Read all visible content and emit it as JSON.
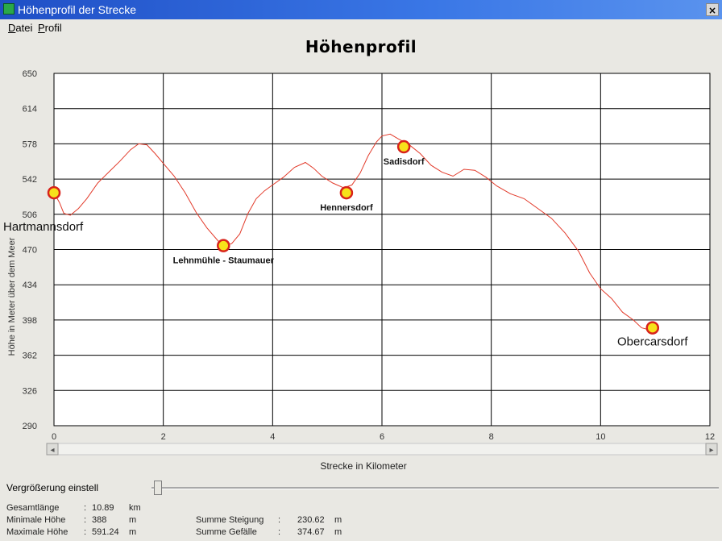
{
  "window": {
    "title": "Höhenprofil der Strecke",
    "close_glyph": "×"
  },
  "menu": [
    "Datei",
    "Profil"
  ],
  "chart_data": {
    "type": "line",
    "title": "Höhenprofil",
    "xlabel": "Strecke in Kilometer",
    "ylabel": "Höhe in Meter über dem Meer",
    "xlim": [
      0,
      12
    ],
    "ylim": [
      290,
      650
    ],
    "xticks": [
      0,
      2,
      4,
      6,
      8,
      10,
      12
    ],
    "yticks": [
      650,
      614,
      578,
      542,
      506,
      470,
      434,
      398,
      362,
      326,
      290
    ],
    "grid": true,
    "line_color": "#e23a2a",
    "series": [
      {
        "points": [
          [
            0.0,
            528
          ],
          [
            0.1,
            518
          ],
          [
            0.18,
            507
          ],
          [
            0.3,
            505
          ],
          [
            0.45,
            512
          ],
          [
            0.6,
            522
          ],
          [
            0.8,
            538
          ],
          [
            1.0,
            549
          ],
          [
            1.2,
            560
          ],
          [
            1.4,
            572
          ],
          [
            1.55,
            578
          ],
          [
            1.7,
            577
          ],
          [
            1.85,
            568
          ],
          [
            2.0,
            558
          ],
          [
            2.2,
            545
          ],
          [
            2.4,
            528
          ],
          [
            2.6,
            508
          ],
          [
            2.8,
            492
          ],
          [
            3.0,
            479
          ],
          [
            3.1,
            474
          ],
          [
            3.25,
            476
          ],
          [
            3.4,
            486
          ],
          [
            3.55,
            507
          ],
          [
            3.7,
            522
          ],
          [
            3.85,
            530
          ],
          [
            4.0,
            536
          ],
          [
            4.2,
            544
          ],
          [
            4.4,
            554
          ],
          [
            4.6,
            559
          ],
          [
            4.75,
            553
          ],
          [
            4.9,
            545
          ],
          [
            5.1,
            538
          ],
          [
            5.3,
            533
          ],
          [
            5.45,
            536
          ],
          [
            5.6,
            548
          ],
          [
            5.75,
            566
          ],
          [
            5.9,
            580
          ],
          [
            6.0,
            586
          ],
          [
            6.15,
            588
          ],
          [
            6.3,
            583
          ],
          [
            6.5,
            577
          ],
          [
            6.7,
            568
          ],
          [
            6.9,
            556
          ],
          [
            7.1,
            549
          ],
          [
            7.3,
            545
          ],
          [
            7.5,
            552
          ],
          [
            7.7,
            551
          ],
          [
            7.9,
            544
          ],
          [
            8.1,
            535
          ],
          [
            8.35,
            527
          ],
          [
            8.6,
            522
          ],
          [
            8.85,
            512
          ],
          [
            9.1,
            502
          ],
          [
            9.35,
            487
          ],
          [
            9.6,
            468
          ],
          [
            9.8,
            446
          ],
          [
            10.0,
            430
          ],
          [
            10.2,
            420
          ],
          [
            10.4,
            406
          ],
          [
            10.6,
            398
          ],
          [
            10.75,
            390
          ],
          [
            10.89,
            388
          ]
        ]
      }
    ],
    "waypoints": [
      {
        "name": "Hartmannsdorf",
        "x": 0.0,
        "y": 528,
        "label_pos": "below-right",
        "label_size": "large"
      },
      {
        "name": "Lehnmühle - Staumauer",
        "x": 3.1,
        "y": 474,
        "label_pos": "below",
        "label_size": "small"
      },
      {
        "name": "Hennersdorf",
        "x": 5.35,
        "y": 528,
        "label_pos": "below",
        "label_size": "small"
      },
      {
        "name": "Sadisdorf",
        "x": 6.4,
        "y": 575,
        "label_pos": "below",
        "label_size": "small"
      },
      {
        "name": "Obercarsdorf",
        "x": 10.95,
        "y": 390,
        "label_pos": "below",
        "label_size": "large"
      }
    ],
    "marker_fill": "#f7e21a",
    "marker_stroke": "#d8221a"
  },
  "scrollbar": {
    "left_arrow": "◂",
    "right_arrow": "▸"
  },
  "zoom": {
    "label": "Vergrößerung einstell"
  },
  "stats": {
    "gesamtlaenge": {
      "label": "Gesamtlänge",
      "value": "10.89",
      "unit": "km"
    },
    "min_hoehe": {
      "label": "Minimale Höhe",
      "value": "388",
      "unit": "m"
    },
    "max_hoehe": {
      "label": "Maximale Höhe",
      "value": "591.24",
      "unit": "m"
    },
    "steigung": {
      "label": "Summe Steigung",
      "value": "230.62",
      "unit": "m"
    },
    "gefaelle": {
      "label": "Summe Gefälle",
      "value": "374.67",
      "unit": "m"
    }
  }
}
